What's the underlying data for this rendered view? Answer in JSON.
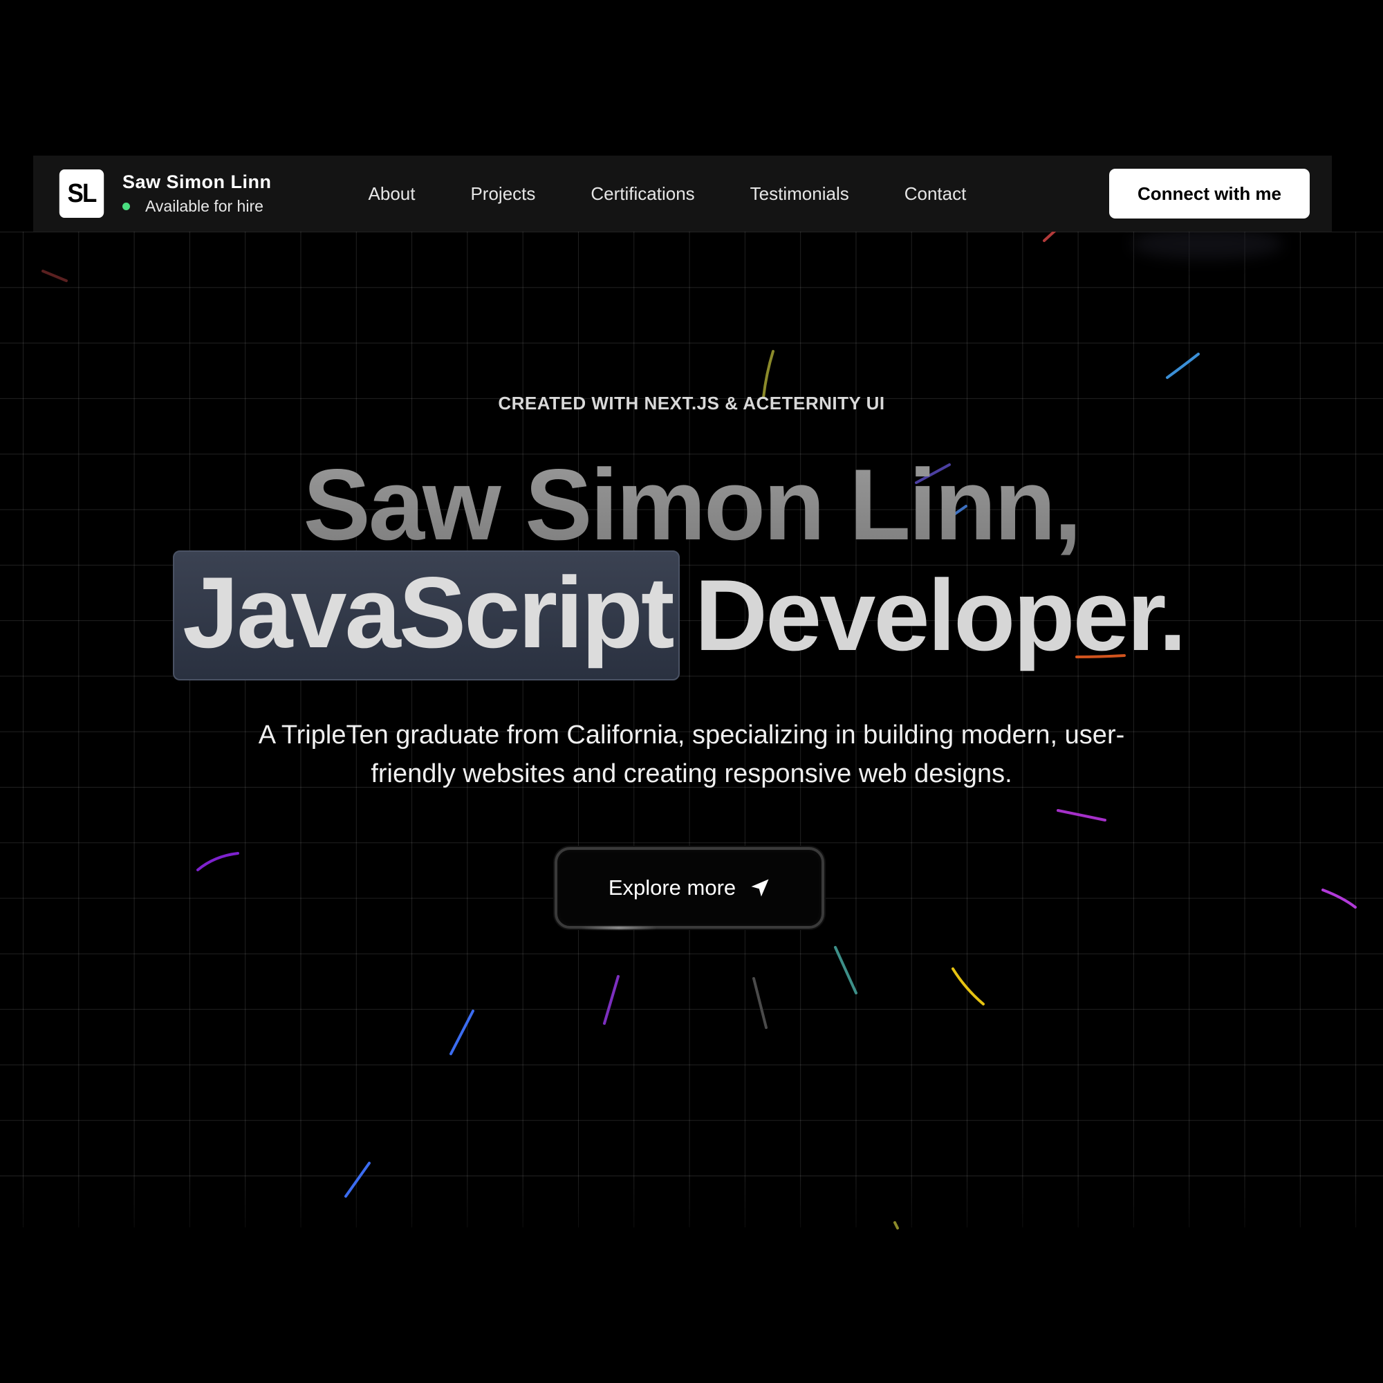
{
  "navbar": {
    "logo_text": "SL",
    "brand_name": "Saw Simon Linn",
    "status_text": "Available for hire",
    "status_color": "#4ade80",
    "links": [
      {
        "label": "About"
      },
      {
        "label": "Projects"
      },
      {
        "label": "Certifications"
      },
      {
        "label": "Testimonials"
      },
      {
        "label": "Contact"
      }
    ],
    "cta_label": "Connect with me"
  },
  "hero": {
    "tagline": "CREATED WITH NEXT.JS & ACETERNITY UI",
    "headline_line1": "Saw Simon Linn,",
    "headline_highlight": "JavaScript",
    "headline_rest": "Developer.",
    "subtitle": "A TripleTen graduate from California, specializing in building modern, user-friendly websites and creating responsive web designs.",
    "explore_label": "Explore more",
    "explore_icon": "send-icon"
  },
  "colors": {
    "background": "#000000",
    "navbar_bg": "#141414",
    "highlight_bg": "#353c4b",
    "grid_line": "#222222"
  }
}
